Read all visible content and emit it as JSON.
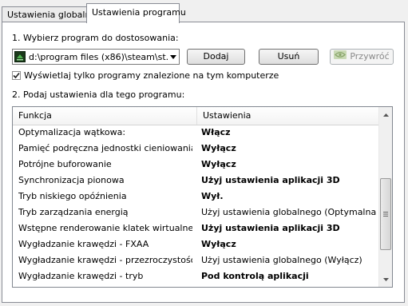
{
  "tabs": [
    "Ustawienia globalne",
    "Ustawienia programu"
  ],
  "step1_label": "1. Wybierz program do dostosowania:",
  "program_select": {
    "value": "d:\\program files (x86)\\steam\\st...",
    "icon": "steam-app-icon"
  },
  "buttons": {
    "add": "Dodaj",
    "remove": "Usuń",
    "restore": "Przywróć"
  },
  "checkbox": {
    "label": "Wyświetlaj tylko programy znalezione na tym komputerze",
    "checked": true
  },
  "step2_label": "2. Podaj ustawienia dla tego programu:",
  "grid": {
    "headers": [
      "Funkcja",
      "Ustawienia"
    ],
    "rows": [
      {
        "feature": "Optymalizacja wątkowa:",
        "setting": "Włącz",
        "bold": true
      },
      {
        "feature": "Pamięć podręczna jednostki cieniowania",
        "setting": "Wyłącz",
        "bold": true
      },
      {
        "feature": "Potrójne buforowanie",
        "setting": "Wyłącz",
        "bold": true
      },
      {
        "feature": "Synchronizacja pionowa",
        "setting": "Użyj ustawienia aplikacji 3D",
        "bold": true
      },
      {
        "feature": "Tryb niskiego opóźnienia",
        "setting": "Wył.",
        "bold": true
      },
      {
        "feature": "Tryb zarządzania energią",
        "setting": "Użyj ustawienia globalnego (Optymalna moc)",
        "bold": false
      },
      {
        "feature": "Wstępne renderowanie klatek wirtualnej r...",
        "setting": "Użyj ustawienia aplikacji 3D",
        "bold": true
      },
      {
        "feature": "Wygładzanie krawędzi - FXAA",
        "setting": "Wyłącz",
        "bold": true
      },
      {
        "feature": "Wygładzanie krawędzi - przezroczystość",
        "setting": "Użyj ustawienia globalnego (Wyłącz)",
        "bold": false
      },
      {
        "feature": "Wygładzanie krawędzi - tryb",
        "setting": "Pod kontrolą aplikacji",
        "bold": true
      }
    ]
  }
}
